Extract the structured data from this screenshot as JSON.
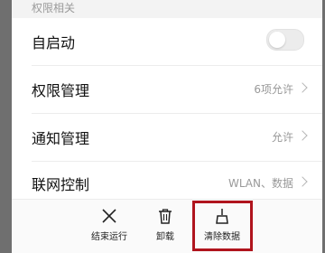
{
  "section": {
    "title": "权限相关"
  },
  "rows": [
    {
      "label": "自启动",
      "value": ""
    },
    {
      "label": "权限管理",
      "value": "6项允许"
    },
    {
      "label": "通知管理",
      "value": "允许"
    },
    {
      "label": "联网控制",
      "value": "WLAN、数据"
    }
  ],
  "autostart": {
    "enabled": false
  },
  "actions": [
    {
      "label": "结束运行",
      "icon": "close-icon"
    },
    {
      "label": "卸载",
      "icon": "trash-icon"
    },
    {
      "label": "清除数据",
      "icon": "broom-icon"
    }
  ],
  "colors": {
    "highlight": "#b0141d",
    "background": "#ffffff",
    "dim": "#6f6f6f"
  }
}
